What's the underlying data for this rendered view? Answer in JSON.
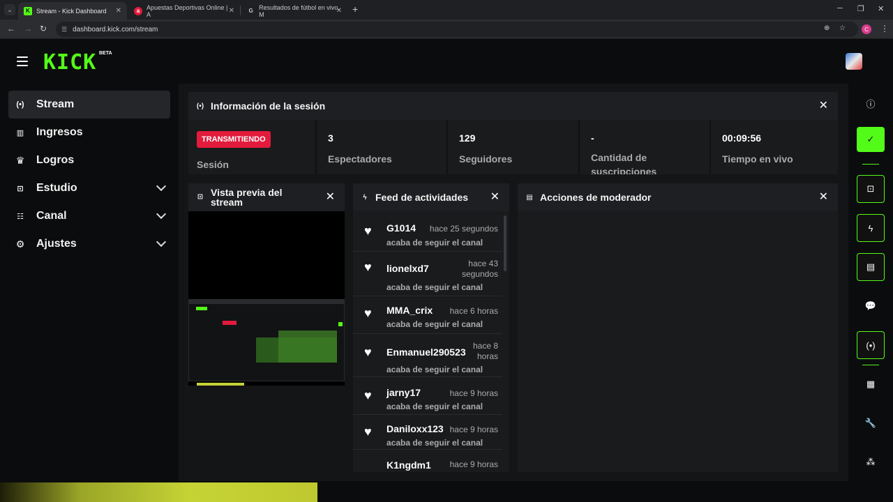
{
  "browser": {
    "tabs": [
      {
        "title": "Stream - Kick Dashboard",
        "favicon": "K",
        "favicon_color": "#53fc18"
      },
      {
        "title": "Apuestas Deportivas Online | A",
        "favicon": "a",
        "favicon_color": "#e21b3c"
      },
      {
        "title": "Resultados de fútbol en vivo, M",
        "favicon": "G",
        "favicon_color": "#cccccc"
      }
    ],
    "url": "dashboard.kick.com/stream",
    "profile_initial": "C"
  },
  "app": {
    "logo": "KICK",
    "logo_badge": "BETA",
    "accent_color": "#53fc18"
  },
  "sidebar": {
    "items": [
      {
        "label": "Stream",
        "icon": "broadcast-icon",
        "active": true,
        "expandable": false
      },
      {
        "label": "Ingresos",
        "icon": "chart-icon",
        "active": false,
        "expandable": false
      },
      {
        "label": "Logros",
        "icon": "trophy-icon",
        "active": false,
        "expandable": false
      },
      {
        "label": "Estudio",
        "icon": "studio-icon",
        "active": false,
        "expandable": true
      },
      {
        "label": "Canal",
        "icon": "channel-icon",
        "active": false,
        "expandable": true
      },
      {
        "label": "Ajustes",
        "icon": "gear-icon",
        "active": false,
        "expandable": true
      }
    ]
  },
  "session": {
    "title": "Información de la sesión",
    "status_badge": "TRANSMITIENDO",
    "status_color": "#e21b3c",
    "status_label": "Sesión",
    "stats": [
      {
        "value": "3",
        "label": "Espectadores"
      },
      {
        "value": "129",
        "label": "Seguidores"
      },
      {
        "value": "-",
        "label": "Cantidad de suscripciones"
      },
      {
        "value": "00:09:56",
        "label": "Tiempo en vivo"
      }
    ]
  },
  "preview": {
    "title": "Vista previa del stream"
  },
  "feed": {
    "title": "Feed de actividades",
    "items": [
      {
        "user": "G1014",
        "time": "hace 25 segundos",
        "action": "acaba de seguir el canal"
      },
      {
        "user": "lionelxd7",
        "time": "hace 43 segundos",
        "action": "acaba de seguir el canal"
      },
      {
        "user": "MMA_crix",
        "time": "hace 6 horas",
        "action": "acaba de seguir el canal"
      },
      {
        "user": "Enmanuel290523",
        "time": "hace 8 horas",
        "action": "acaba de seguir el canal"
      },
      {
        "user": "jarny17",
        "time": "hace 9 horas",
        "action": "acaba de seguir el canal"
      },
      {
        "user": "Daniloxx123",
        "time": "hace 9 horas",
        "action": "acaba de seguir el canal"
      },
      {
        "user": "K1ngdm1",
        "time": "hace 9 horas",
        "action": ""
      }
    ]
  },
  "moderator": {
    "title": "Acciones de moderador"
  },
  "rail": {
    "buttons": [
      "info-icon",
      "check-icon",
      "screen-capture-icon",
      "lightning-icon",
      "notes-icon",
      "chat-icon",
      "broadcast-icon",
      "layout-icon",
      "wrench-icon",
      "connections-icon"
    ]
  }
}
